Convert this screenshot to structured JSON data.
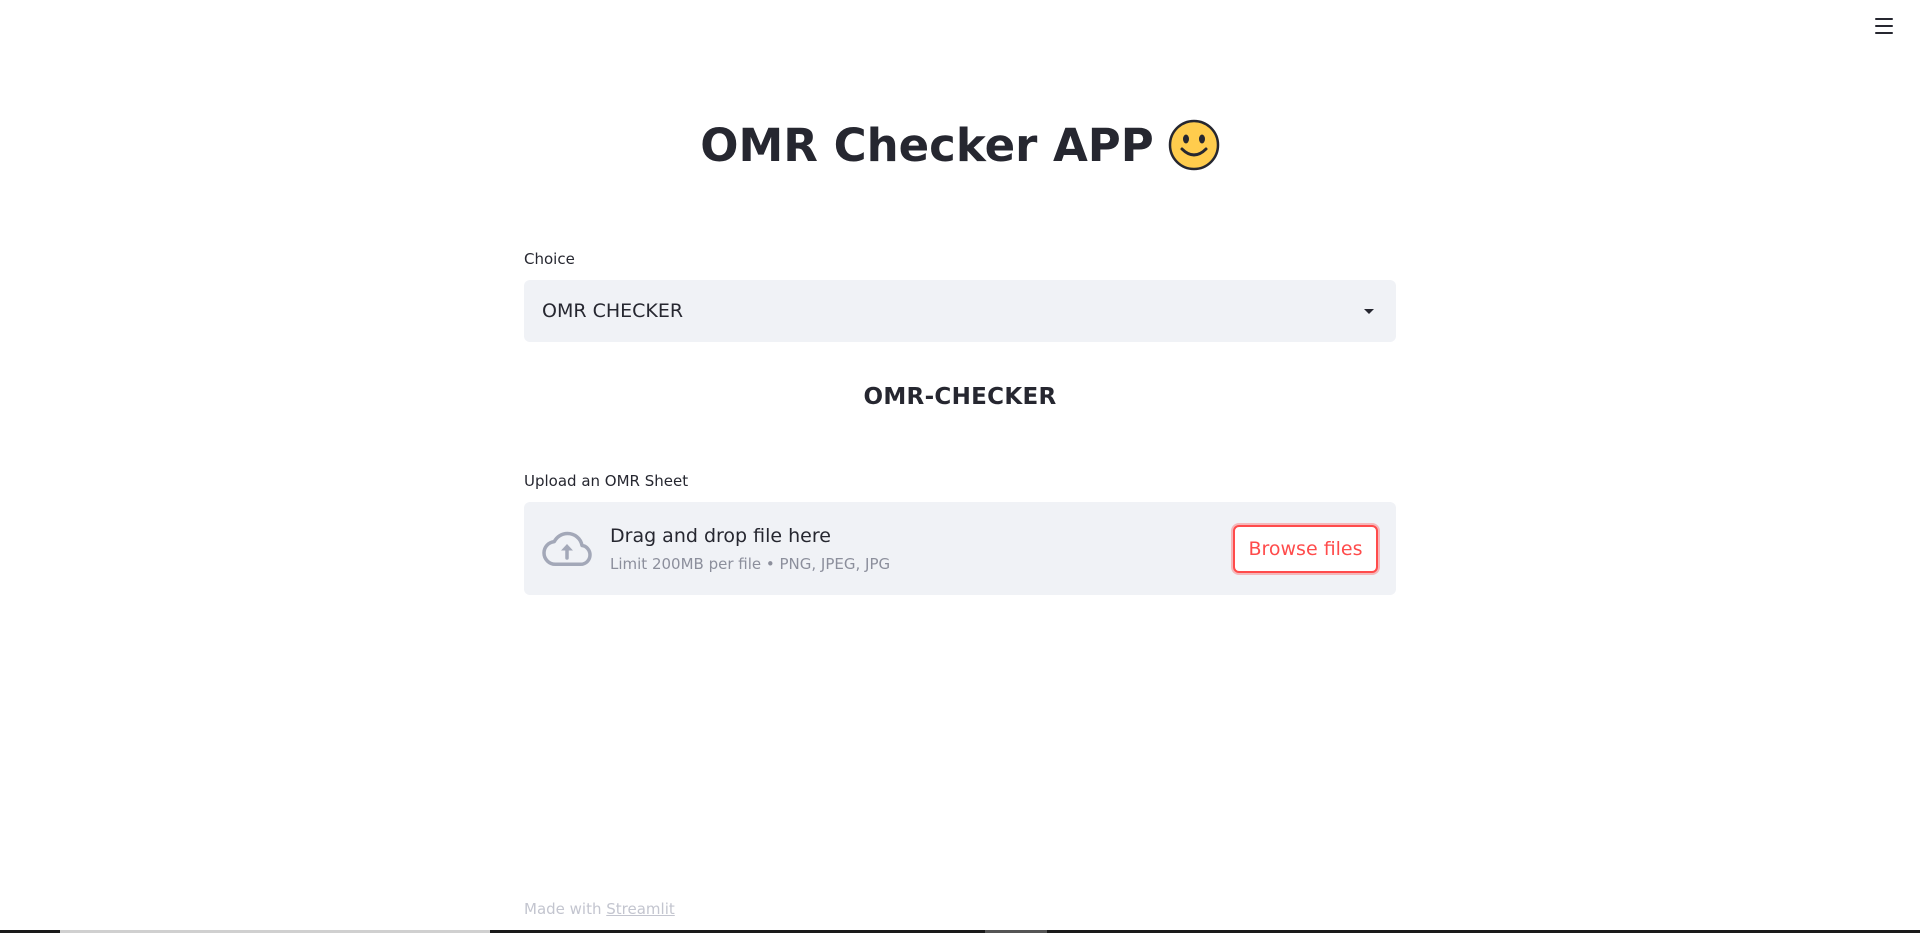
{
  "header": {
    "menu_icon": "hamburger-menu-icon"
  },
  "main": {
    "title": "OMR Checker APP",
    "title_emoji": "slightly-smiling-face-icon",
    "choice": {
      "label": "Choice",
      "selected": "OMR CHECKER",
      "icon": "caret-down-icon"
    },
    "subheader": "OMR-CHECKER",
    "uploader": {
      "label": "Upload an OMR Sheet",
      "icon": "cloud-upload-icon",
      "primary_text": "Drag and drop file here",
      "secondary_text": "Limit 200MB per file • PNG, JPEG, JPG",
      "button_label": "Browse files"
    }
  },
  "footer": {
    "prefix": "Made with",
    "link_text": "Streamlit"
  },
  "colors": {
    "accent": "#ff4b4b",
    "text": "#262730",
    "input_bg": "#f0f2f6",
    "muted": "#8c8f9c",
    "footer": "#c3c5cf"
  }
}
